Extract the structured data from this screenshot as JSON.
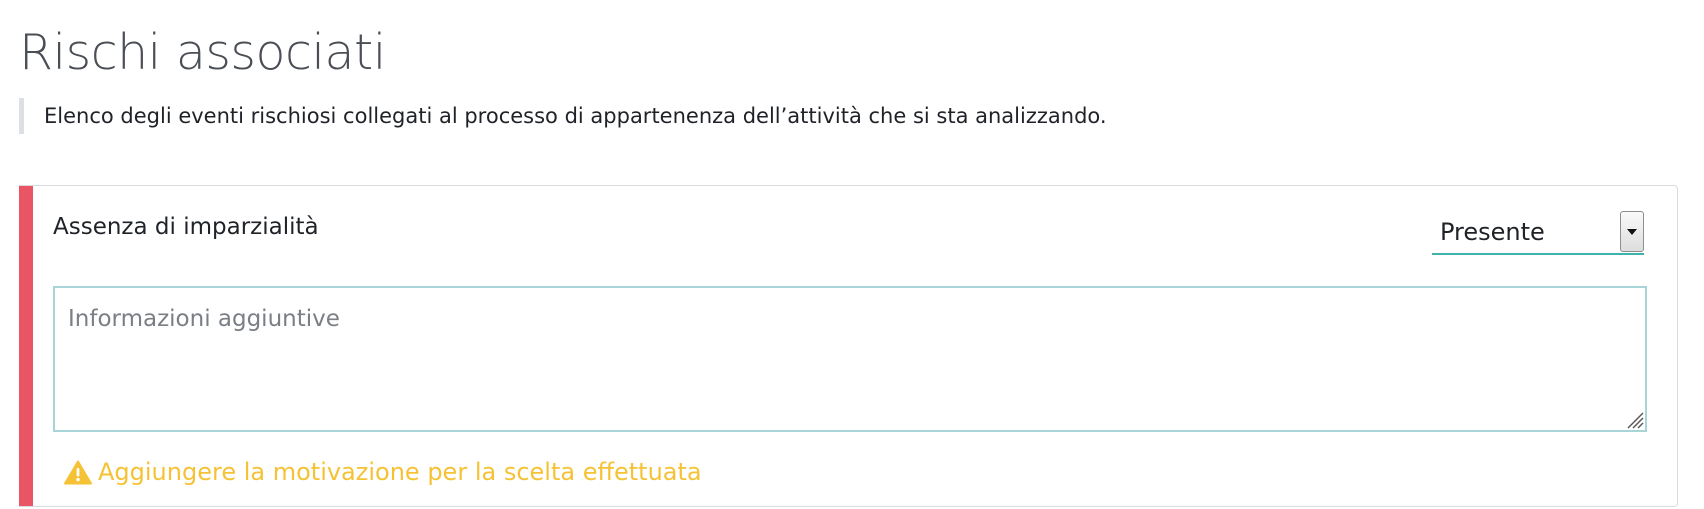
{
  "page": {
    "title": "Rischi associati",
    "description": "Elenco degli eventi rischiosi collegati al processo di appartenenza dell’attività che si sta analizzando."
  },
  "risk": {
    "name": "Assenza di imparzialità",
    "status_select": {
      "selected": "Presente"
    },
    "notes": {
      "value": "",
      "placeholder": "Informazioni aggiuntive"
    },
    "warning": {
      "icon": "warning-triangle-icon",
      "text": "Aggiungere la motivazione per la scelta effettuata"
    }
  },
  "colors": {
    "accent_danger": "#ea5566",
    "warning": "#f6c235",
    "select_underline": "#3fb2ac",
    "textarea_border": "#a8d6d8"
  }
}
